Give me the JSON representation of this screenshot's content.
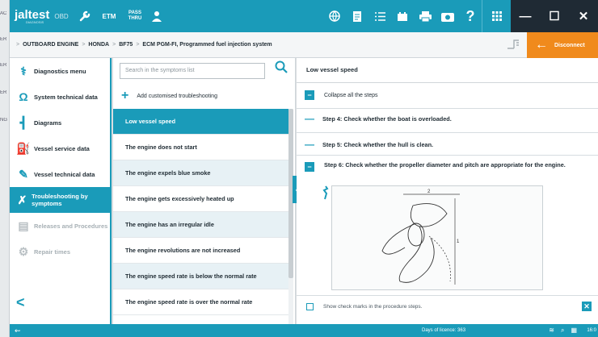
{
  "topbar": {
    "brand": "jaltest",
    "brand_sub": "DIAGNOSIS",
    "section": "OBD",
    "etm_label": "ETM",
    "pass_thru_label_1": "PASS",
    "pass_thru_label_2": "THRU",
    "icons": [
      "wrench-icon",
      "person-icon",
      "globe-icon",
      "document-icon",
      "list-icon",
      "battery-icon",
      "printer-icon",
      "camera-icon",
      "help-icon",
      "grid-icon",
      "minimize-icon",
      "maximize-icon",
      "close-icon"
    ],
    "help_label": "?",
    "minimize_label": "—",
    "maximize_label": "☐",
    "close_label": "✕"
  },
  "breadcrumb": {
    "items": [
      "OUTBOARD ENGINE",
      "HONDA",
      "BF75",
      "ECM PGM-FI, Programmed fuel injection system"
    ],
    "separator": ">"
  },
  "disconnect": {
    "label": "Disconnect"
  },
  "left_menu": {
    "items": [
      {
        "label": "Diagnostics menu",
        "icon": "stethoscope-icon",
        "state": "normal"
      },
      {
        "label": "System technical data",
        "icon": "ohm-icon",
        "state": "normal"
      },
      {
        "label": "Diagrams",
        "icon": "diagram-icon",
        "state": "normal"
      },
      {
        "label": "Vessel service data",
        "icon": "oil-can-icon",
        "state": "normal"
      },
      {
        "label": "Vessel technical data",
        "icon": "wrench-icon",
        "state": "normal"
      },
      {
        "label": "Troubleshooting by symptoms",
        "icon": "tools-icon",
        "state": "active"
      },
      {
        "label": "Releases and Procedures",
        "icon": "clipboard-icon",
        "state": "disabled"
      },
      {
        "label": "Repair times",
        "icon": "gear-icon",
        "state": "disabled"
      }
    ],
    "back_label": "<"
  },
  "symptoms": {
    "search_placeholder": "Search in the symptoms list",
    "add_label": "Add customised troubleshooting",
    "items": [
      "Low vessel speed",
      "The engine does not start",
      "The engine expels blue smoke",
      "The engine gets excessively heated up",
      "The engine has an irregular idle",
      "The engine revolutions are not increased",
      "The engine speed rate is below the normal rate",
      "The engine speed rate is over the normal rate"
    ],
    "selected_index": 0
  },
  "steps": {
    "title": "Low vessel speed",
    "collapse_all_label": "Collapse all the steps",
    "step4": "Step 4: Check whether the boat is overloaded.",
    "step5": "Step 5: Check whether the hull is clean.",
    "step6": "Step 6: Check whether the propeller diameter and pitch are appropriate for the engine.",
    "figure_dim_2": "2",
    "figure_dim_1": "1",
    "show_checkmarks_label": "Show check marks in the procedure steps."
  },
  "statusbar": {
    "days_label": "Days of licence: 363",
    "time": "16:0"
  },
  "background_window_letters": [
    "AC",
    "ER",
    "ER",
    "ER",
    "NG"
  ],
  "colors": {
    "accent": "#1a9bb9",
    "orange": "#f08a1c",
    "dark": "#1f2a34"
  }
}
